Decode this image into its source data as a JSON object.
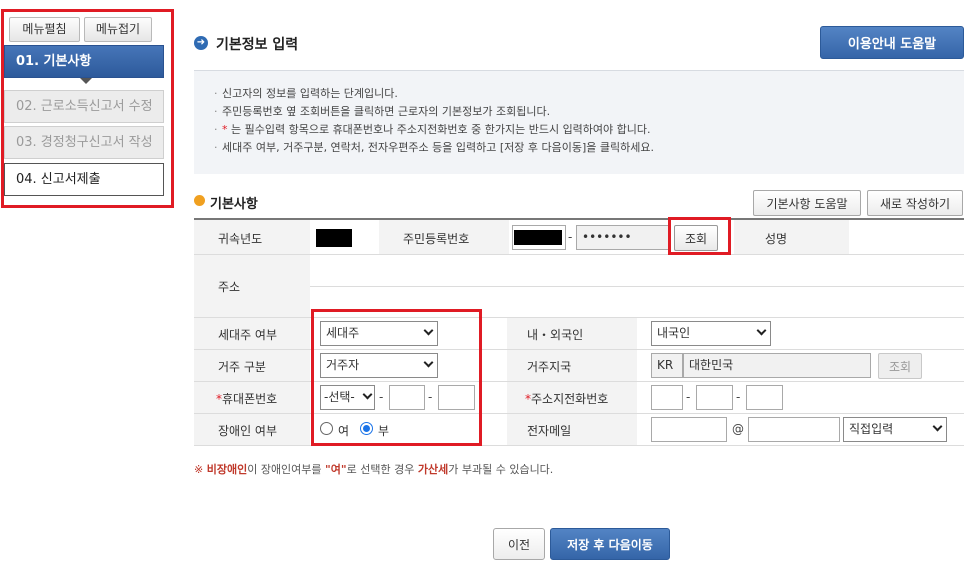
{
  "sidebar": {
    "toggle_open": "메뉴펼침",
    "toggle_close": "메뉴접기",
    "steps": [
      {
        "label": "01. 기본사항",
        "state": "active"
      },
      {
        "label": "02. 근로소득신고서 수정",
        "state": "disabled"
      },
      {
        "label": "03. 경정청구신고서 작성",
        "state": "disabled"
      },
      {
        "label": "04. 신고서제출",
        "state": "normal"
      }
    ]
  },
  "header": {
    "title": "기본정보 입력",
    "help_button": "이용안내 도움말",
    "icon": "arrow-circle-icon"
  },
  "info": {
    "line1": "신고자의 정보를 입력하는 단계입니다.",
    "line2": "주민등록번호 옆 조회버튼을 클릭하면 근로자의 기본정보가 조회됩니다.",
    "line3_star": "*",
    "line3": " 는 필수입력 항목으로 휴대폰번호나 주소지전화번호 중 한가지는 반드시 입력하여야 합니다.",
    "line4": "세대주 여부, 거주구분, 연락처, 전자우편주소 등을 입력하고 [저장 후 다음이동]을 클릭하세요."
  },
  "section": {
    "title": "기본사항",
    "help_button": "기본사항 도움말",
    "new_button": "새로 작성하기"
  },
  "form": {
    "year_label": "귀속년도",
    "rrn_label": "주민등록번호",
    "rrn_dash": "-",
    "rrn_back": "•••••••",
    "search_button": "조회",
    "name_label": "성명",
    "address_label": "주소",
    "household_label": "세대주 여부",
    "household_value": "세대주",
    "nationality_label": "내・외국인",
    "nationality_value": "내국인",
    "residence_label": "거주 구분",
    "residence_value": "거주자",
    "residence_region_label": "거주지국",
    "residence_region_code": "KR",
    "residence_region_name": "대한민국",
    "region_search_button": "조회",
    "mobile_star": "*",
    "mobile_label": "휴대폰번호",
    "mobile_select": "-선택-",
    "dash": "-",
    "home_phone_star": "*",
    "home_phone_label": "주소지전화번호",
    "disability_label": "장애인 여부",
    "disability_yes": "여",
    "disability_no": "부",
    "disability_selected": "부",
    "email_label": "전자메일",
    "email_at": "@",
    "email_domain_select": "직접입력"
  },
  "notice": {
    "mark": "※",
    "highlight1": "비장애인",
    "text1": "이 장애인여부를 ",
    "highlight2": "\"여\"",
    "text2": "로 선택한 경우 ",
    "highlight3": "가산세",
    "text3": "가 부과될 수 있습니다."
  },
  "footer": {
    "prev_button": "이전",
    "next_button": "저장 후 다음이동"
  },
  "colors": {
    "accent_blue": "#3565a8",
    "highlight_red": "#e01b24",
    "section_icon": "#f0a020"
  }
}
